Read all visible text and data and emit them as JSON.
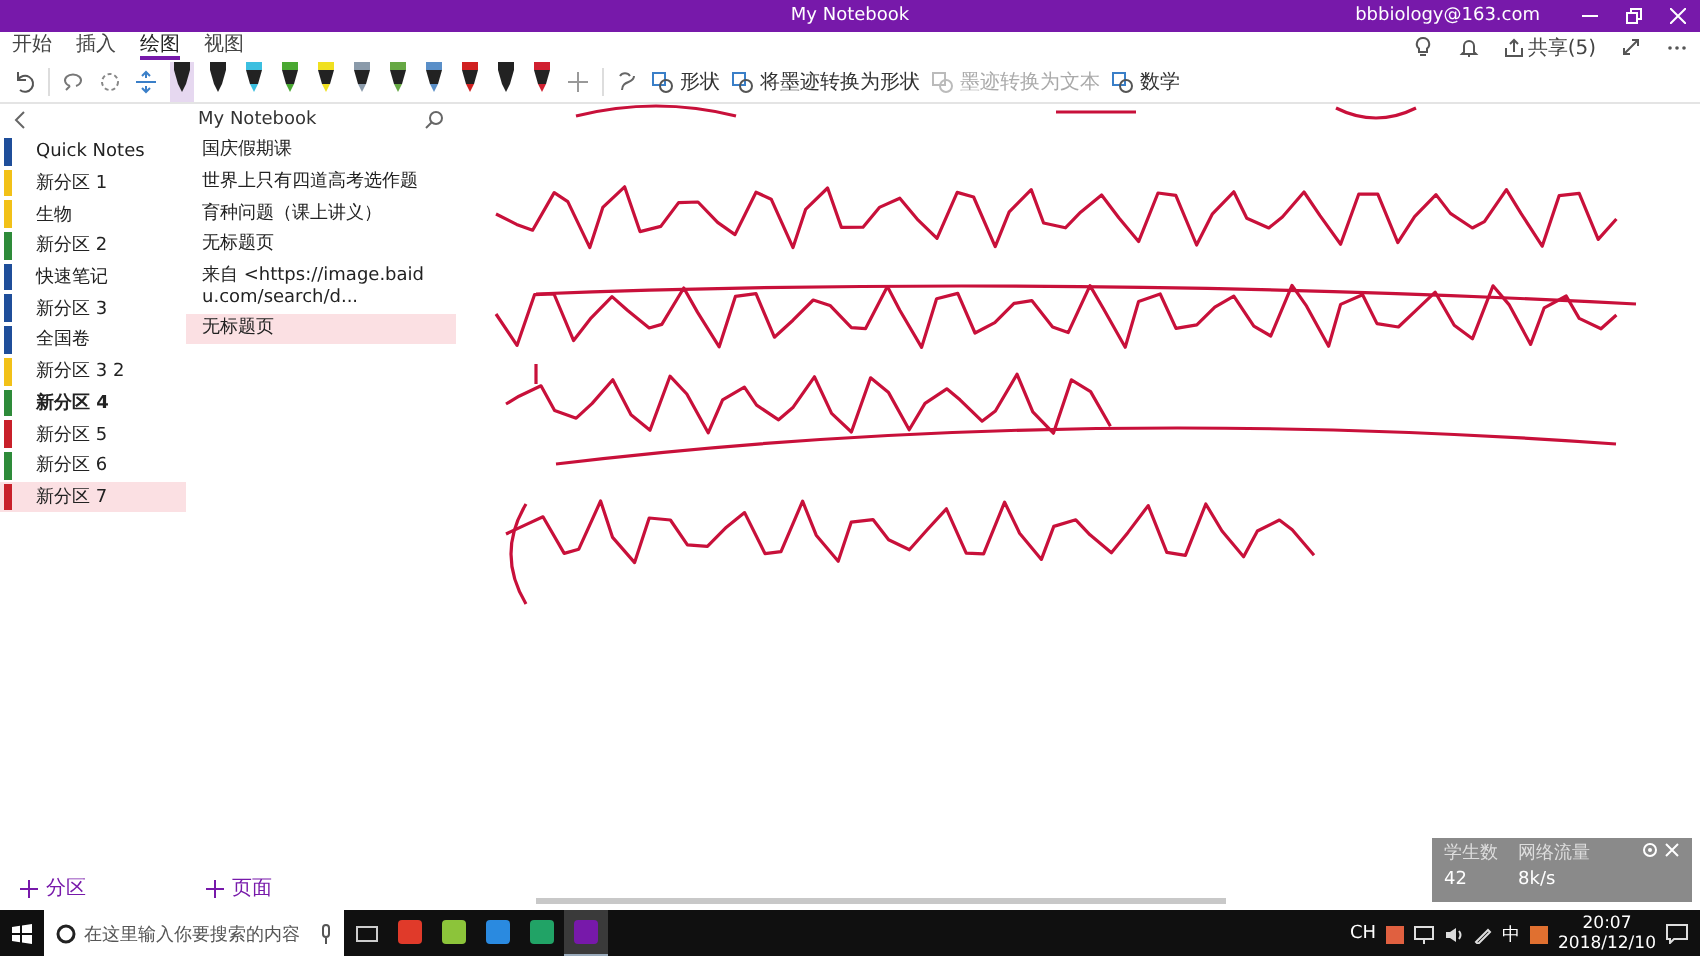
{
  "window": {
    "title": "My Notebook",
    "account": "bbbiology@163.com"
  },
  "ribbon_tabs": [
    {
      "label": "开始",
      "selected": false
    },
    {
      "label": "插入",
      "selected": false
    },
    {
      "label": "绘图",
      "selected": true
    },
    {
      "label": "视图",
      "selected": false
    }
  ],
  "share": "共享(5)",
  "toolbar": {
    "pens": [
      {
        "color": "#222222",
        "selected": true
      },
      {
        "color": "#222222",
        "selected": false
      },
      {
        "color": "#3cbfe0",
        "selected": false
      },
      {
        "color": "#4aa832",
        "selected": false
      },
      {
        "color": "#f0e020",
        "selected": false
      },
      {
        "color": "#8a9aaa",
        "selected": false
      },
      {
        "color": "#66a844",
        "selected": false
      },
      {
        "color": "#5a8fc8",
        "selected": false
      },
      {
        "color": "#d02020",
        "selected": false
      },
      {
        "color": "#222222",
        "selected": false
      },
      {
        "color": "#d02030",
        "selected": false
      }
    ],
    "buttons": [
      {
        "label": "形状",
        "disabled": false
      },
      {
        "label": "将墨迹转换为形状",
        "disabled": false
      },
      {
        "label": "墨迹转换为文本",
        "disabled": true
      },
      {
        "label": "数学",
        "disabled": false
      }
    ]
  },
  "notebook": {
    "title": "My Notebook"
  },
  "sections": [
    {
      "name": "Quick Notes",
      "color": "#1f4e9a",
      "selected": false,
      "unread": false
    },
    {
      "name": "新分区 1",
      "color": "#f2c118",
      "selected": false,
      "unread": false
    },
    {
      "name": "生物",
      "color": "#f2c118",
      "selected": false,
      "unread": false
    },
    {
      "name": "新分区 2",
      "color": "#2e8b3a",
      "selected": false,
      "unread": false
    },
    {
      "name": "快速笔记",
      "color": "#1f4e9a",
      "selected": false,
      "unread": false
    },
    {
      "name": "新分区 3",
      "color": "#1f4e9a",
      "selected": false,
      "unread": false
    },
    {
      "name": "全国卷",
      "color": "#1f4e9a",
      "selected": false,
      "unread": false
    },
    {
      "name": "新分区 3 2",
      "color": "#f2c118",
      "selected": false,
      "unread": false
    },
    {
      "name": "新分区 4",
      "color": "#2e8b3a",
      "selected": false,
      "unread": true
    },
    {
      "name": "新分区 5",
      "color": "#c8202a",
      "selected": false,
      "unread": false
    },
    {
      "name": "新分区 6",
      "color": "#2e8b3a",
      "selected": false,
      "unread": false
    },
    {
      "name": "新分区 7",
      "color": "#c8202a",
      "selected": true,
      "unread": false
    }
  ],
  "pages": [
    {
      "title": "国庆假期课",
      "selected": false
    },
    {
      "title": "世界上只有四道高考选作题",
      "selected": false
    },
    {
      "title": "育种问题（课上讲义）",
      "selected": false
    },
    {
      "title": "无标题页",
      "selected": false
    },
    {
      "title": "来自 <https://image.baidu.com/search/d...",
      "selected": false
    },
    {
      "title": "无标题页",
      "selected": true
    }
  ],
  "add_section": "分区",
  "add_page": "页面",
  "overlay": {
    "stats": [
      {
        "label": "学生数",
        "value": "42"
      },
      {
        "label": "网络流量",
        "value": "8k/s"
      }
    ]
  },
  "taskbar": {
    "search_placeholder": "在这里输入你要搜索的内容",
    "apps": [
      {
        "color": "#e03a2a",
        "selected": false
      },
      {
        "color": "#8cc43a",
        "selected": false
      },
      {
        "color": "#2a8ae0",
        "selected": false
      },
      {
        "color": "#21a366",
        "selected": false
      },
      {
        "color": "#7719aa",
        "selected": true
      }
    ],
    "language": "CH",
    "input_method": "中",
    "time": "20:07",
    "date": "2018/12/10"
  }
}
